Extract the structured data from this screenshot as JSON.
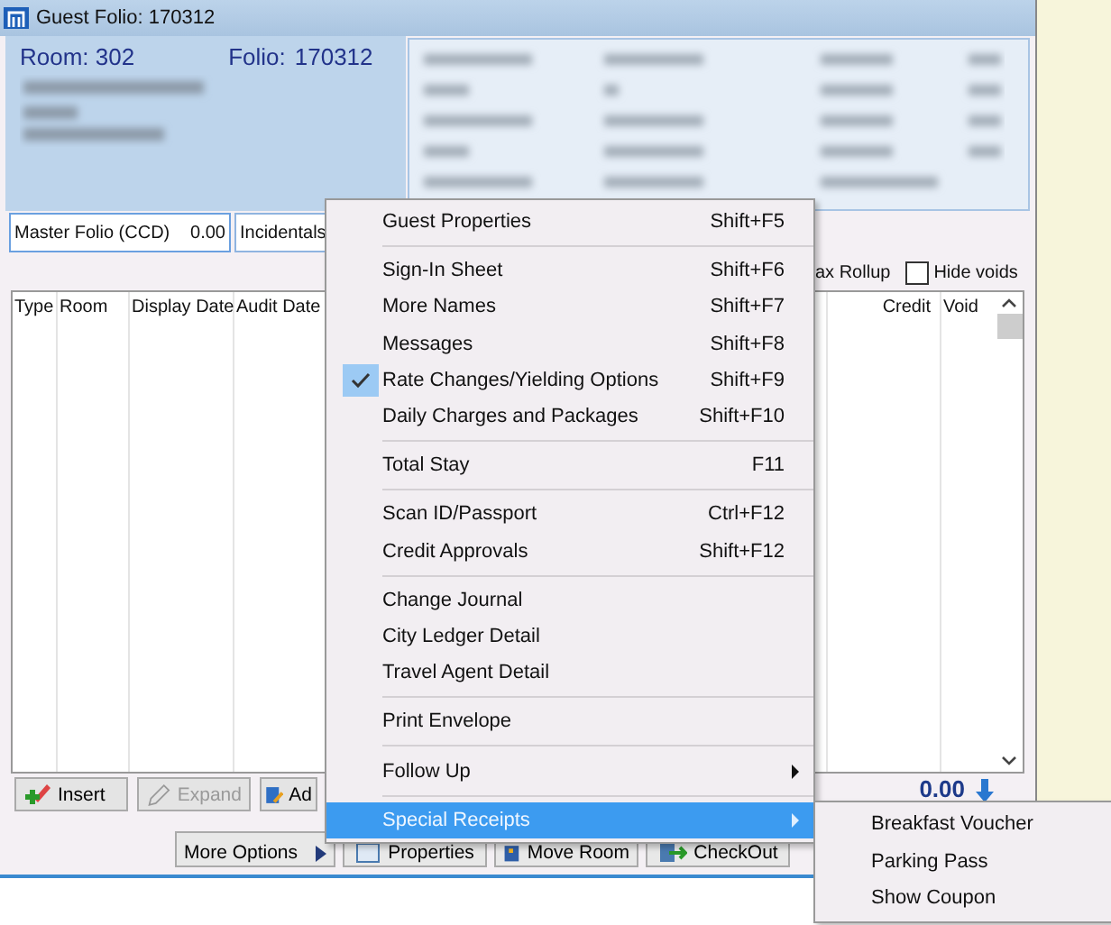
{
  "window": {
    "title": "Guest Folio: 170312"
  },
  "header": {
    "room": "Room: 302",
    "folio_label": "Folio:",
    "folio": "170312"
  },
  "folio_tabs": [
    {
      "label": "Master Folio (CCD)",
      "amount": "0.00",
      "selected": true
    },
    {
      "label": "Incidentals",
      "selected": false
    }
  ],
  "options": {
    "rollup_label": "ax Rollup",
    "hide_voids": {
      "label": "Hide voids",
      "checked": false
    }
  },
  "table": {
    "columns": [
      {
        "label": "Type",
        "kind": "left"
      },
      {
        "label": "Room",
        "kind": "left"
      },
      {
        "label": "Display Date",
        "kind": "left"
      },
      {
        "label": "Audit Date",
        "kind": "left"
      },
      {
        "kind": "hidden"
      },
      {
        "label": "Credit",
        "kind": "right"
      },
      {
        "label": "Void",
        "kind": "left"
      }
    ]
  },
  "action_buttons": [
    {
      "label": "Insert",
      "kind": "insert",
      "disabled": false
    },
    {
      "label": "Expand",
      "kind": "expand",
      "disabled": true
    },
    {
      "label": "Ad",
      "kind": "adjust",
      "disabled": false
    }
  ],
  "balance": "0.00",
  "bottom_buttons": [
    {
      "label": "More Options",
      "kind": "more"
    },
    {
      "label": "Properties",
      "kind": "properties"
    },
    {
      "label": "Move Room",
      "kind": "move"
    },
    {
      "label": "CheckOut",
      "kind": "checkout"
    }
  ],
  "context_menu": {
    "items": [
      {
        "kind": "item",
        "label": "Guest Properties",
        "shortcut": "Shift+F5",
        "checked": false,
        "submenu": false,
        "selected": false
      },
      {
        "kind": "separator"
      },
      {
        "kind": "item",
        "label": "Sign-In Sheet",
        "shortcut": "Shift+F6",
        "checked": false,
        "submenu": false,
        "selected": false
      },
      {
        "kind": "item",
        "label": "More Names",
        "shortcut": "Shift+F7",
        "checked": false,
        "submenu": false,
        "selected": false
      },
      {
        "kind": "item",
        "label": "Messages",
        "shortcut": "Shift+F8",
        "checked": false,
        "submenu": false,
        "selected": false
      },
      {
        "kind": "item",
        "label": "Rate Changes/Yielding Options",
        "shortcut": "Shift+F9",
        "checked": true,
        "submenu": false,
        "selected": false
      },
      {
        "kind": "item",
        "label": "Daily Charges and Packages",
        "shortcut": "Shift+F10",
        "checked": false,
        "submenu": false,
        "selected": false
      },
      {
        "kind": "separator"
      },
      {
        "kind": "item",
        "label": "Total Stay",
        "shortcut": "F11",
        "checked": false,
        "submenu": false,
        "selected": false
      },
      {
        "kind": "separator"
      },
      {
        "kind": "item",
        "label": "Scan ID/Passport",
        "shortcut": "Ctrl+F12",
        "checked": false,
        "submenu": false,
        "selected": false
      },
      {
        "kind": "item",
        "label": "Credit Approvals",
        "shortcut": "Shift+F12",
        "checked": false,
        "submenu": false,
        "selected": false
      },
      {
        "kind": "separator"
      },
      {
        "kind": "item",
        "label": "Change Journal",
        "checked": false,
        "submenu": false,
        "selected": false
      },
      {
        "kind": "item",
        "label": "City Ledger Detail",
        "checked": false,
        "submenu": false,
        "selected": false
      },
      {
        "kind": "item",
        "label": "Travel Agent Detail",
        "checked": false,
        "submenu": false,
        "selected": false
      },
      {
        "kind": "separator"
      },
      {
        "kind": "item",
        "label": "Print Envelope",
        "checked": false,
        "submenu": false,
        "selected": false
      },
      {
        "kind": "separator"
      },
      {
        "kind": "item",
        "label": "Follow Up",
        "checked": false,
        "submenu": true,
        "selected": false
      },
      {
        "kind": "separator"
      },
      {
        "kind": "item",
        "label": "Special Receipts",
        "checked": false,
        "submenu": true,
        "selected": true
      }
    ]
  },
  "submenu": {
    "items": [
      {
        "label": "Breakfast Voucher"
      },
      {
        "label": "Parking Pass"
      },
      {
        "label": "Show Coupon"
      }
    ]
  }
}
